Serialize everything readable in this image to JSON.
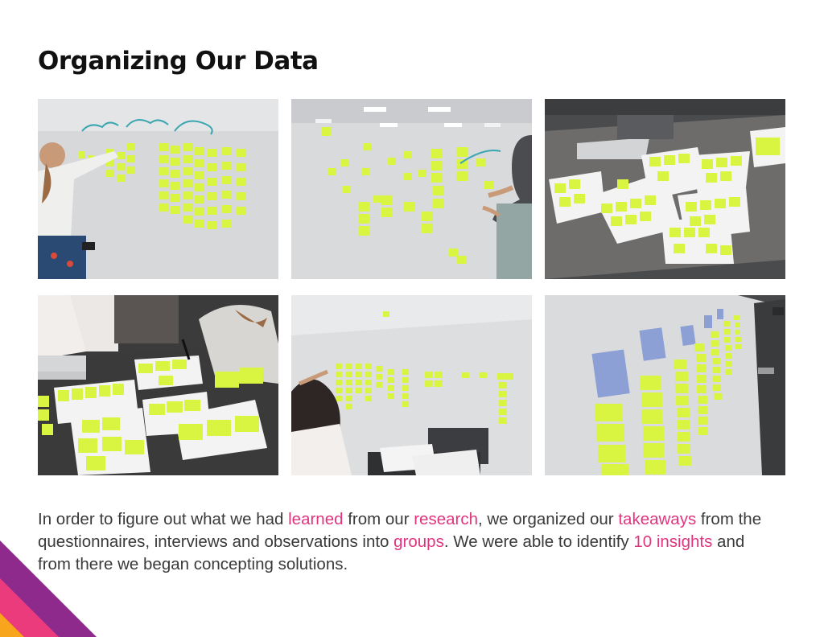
{
  "title": "Organizing Our Data",
  "colors": {
    "highlight": "#e0357f",
    "accent_purple": "#8e2a8c",
    "accent_pink": "#ec3b7c",
    "accent_orange": "#f7a51c",
    "sticky_note": "#d9f542"
  },
  "photos": [
    {
      "name": "man-placing-notes-on-whiteboard"
    },
    {
      "name": "woman-placing-notes-on-whiteboard"
    },
    {
      "name": "notes-sorted-on-paper-on-table"
    },
    {
      "name": "team-writing-notes-at-table"
    },
    {
      "name": "notes-rows-on-whiteboard"
    },
    {
      "name": "notes-clusters-on-glass-wall"
    }
  ],
  "paragraph": {
    "s1": "In order to figure out what we had ",
    "h1": "learned",
    "s2": " from our ",
    "h2": "research",
    "s3": ", we organized our ",
    "h3": "takeaways",
    "s4": " from the questionnaires, interviews and observations into ",
    "h4": "groups",
    "s5": ". We were able to identify ",
    "h5": "10 insights",
    "s6": " and from there we began concepting solutions."
  }
}
